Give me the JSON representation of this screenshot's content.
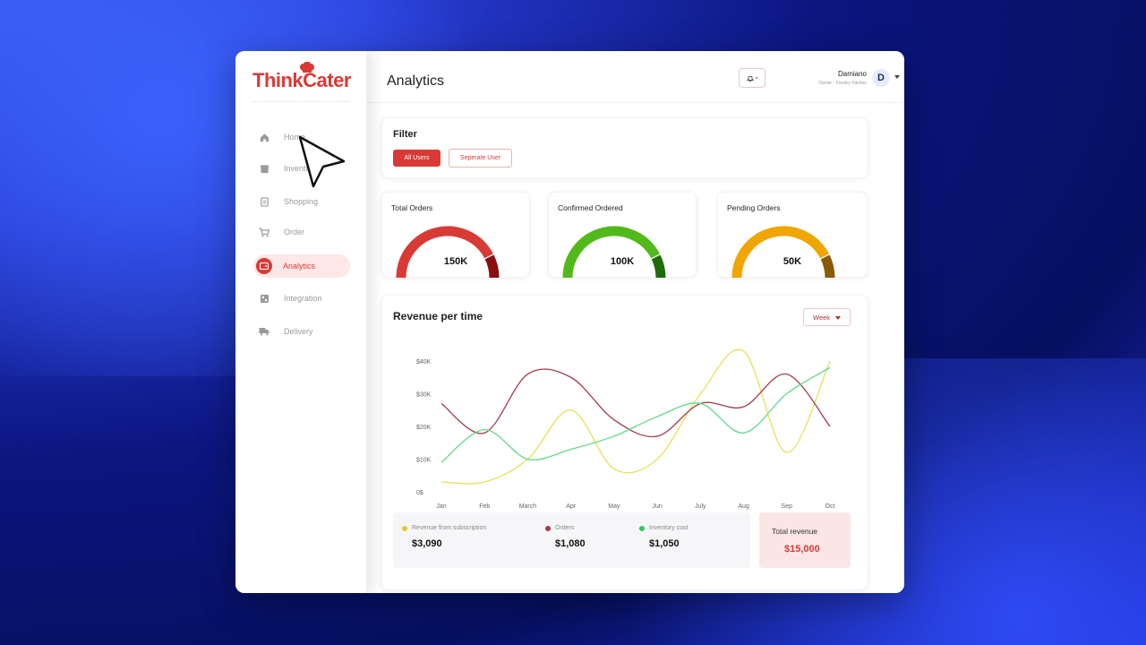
{
  "app": {
    "logo": "ThinkCater",
    "page_title": "Analytics"
  },
  "sidebar": {
    "items": [
      {
        "label": "Home",
        "icon": "home-icon"
      },
      {
        "label": "Inventory",
        "icon": "inventory-icon"
      },
      {
        "label": "Shopping",
        "icon": "shopping-icon"
      },
      {
        "label": "Order",
        "icon": "cart-icon"
      },
      {
        "label": "Analytics",
        "icon": "analytics-icon",
        "active": true
      },
      {
        "label": "Integration",
        "icon": "integration-icon"
      },
      {
        "label": "Delivery",
        "icon": "delivery-icon"
      }
    ]
  },
  "user": {
    "name": "Damiano",
    "role": "Owner - Foodcy Kitchen",
    "initial": "D"
  },
  "filter": {
    "title": "Filter",
    "all_users": "All Users",
    "separate_user": "Seperate User"
  },
  "gauges": [
    {
      "title": "Total Orders",
      "value": "150K",
      "fill": 0.85,
      "color": "#d93a36",
      "dark": "#8b0d0d"
    },
    {
      "title": "Confirmed Ordered",
      "value": "100K",
      "fill": 0.85,
      "color": "#52b91a",
      "dark": "#1f6d0a"
    },
    {
      "title": "Pending Orders",
      "value": "50K",
      "fill": 0.85,
      "color": "#f0a500",
      "dark": "#8a5a06"
    }
  ],
  "revenue": {
    "title": "Revenue per time",
    "period": "Week"
  },
  "chart_data": {
    "type": "line",
    "title": "Revenue per time",
    "categories": [
      "Jan",
      "Feb",
      "March",
      "Apr",
      "May",
      "Jun",
      "July",
      "Aug",
      "Sep",
      "Oct"
    ],
    "y_ticks": [
      "0$",
      "$10K",
      "$20K",
      "$30K",
      "$40K"
    ],
    "ylim": [
      0,
      40000
    ],
    "series": [
      {
        "name": "Revenue from subscription",
        "color": "#e6e05a",
        "values": [
          3000,
          3000,
          10000,
          25000,
          7000,
          10000,
          30000,
          43000,
          12000,
          40000
        ]
      },
      {
        "name": "Orders",
        "color": "#a63a4c",
        "values": [
          27000,
          18000,
          36000,
          35000,
          22000,
          17000,
          27000,
          26000,
          36000,
          20000
        ]
      },
      {
        "name": "Inventory cost",
        "color": "#5fd98a",
        "values": [
          9000,
          19000,
          10000,
          13000,
          17000,
          23000,
          27000,
          18000,
          30000,
          38000
        ]
      }
    ]
  },
  "summary": {
    "subscription_label": "Revenue from subscription",
    "subscription_value": "$3,090",
    "orders_label": "Orders",
    "orders_value": "$1,080",
    "inventory_label": "Inventory cost",
    "inventory_value": "$1,050",
    "total_label": "Total revenue",
    "total_value": "$15,000"
  },
  "colors": {
    "brand": "#d93a36",
    "subscription": "#e6c82e",
    "orders": "#a63a4c",
    "inventory": "#2ec866"
  }
}
